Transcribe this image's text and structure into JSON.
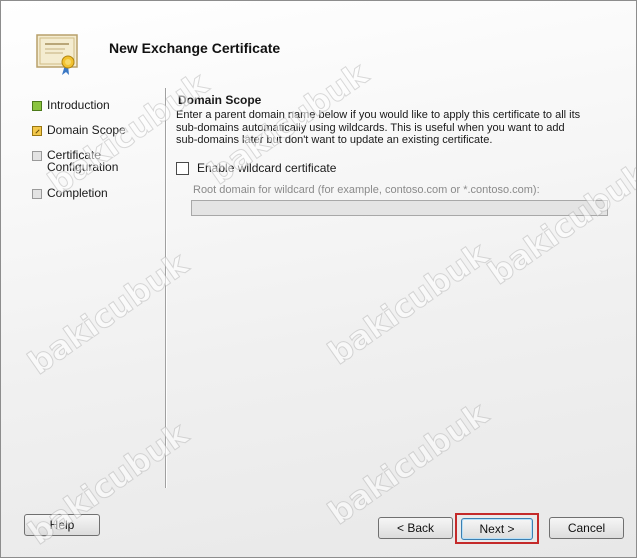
{
  "window": {
    "title": "New Exchange Certificate",
    "icon": "certificate-icon"
  },
  "steps": [
    {
      "label": "Introduction",
      "state": "done"
    },
    {
      "label": "Domain Scope",
      "state": "current"
    },
    {
      "label": "Certificate\nConfiguration",
      "state": "pending"
    },
    {
      "label": "Completion",
      "state": "pending"
    }
  ],
  "main": {
    "section_title": "Domain Scope",
    "description": "Enter a parent domain name below if you would like to apply this certificate to all its\nsub-domains automatically using wildcards. This is useful when you want to add\nsub-domains later but don't want to update an existing certificate.",
    "wildcard_checkbox": {
      "label": "Enable wildcard certificate",
      "checked": false
    },
    "root_domain": {
      "label": "Root domain for wildcard (for example, contoso.com or *.contoso.com):",
      "value": "",
      "enabled": false
    }
  },
  "buttons": {
    "help": "Help",
    "back": "< Back",
    "next": "Next >",
    "cancel": "Cancel"
  },
  "watermark": {
    "text": "bakicubuk"
  },
  "colors": {
    "highlight_border": "#c42a2a",
    "step_done": "#8ac43f",
    "step_current": "#f3c84b"
  }
}
